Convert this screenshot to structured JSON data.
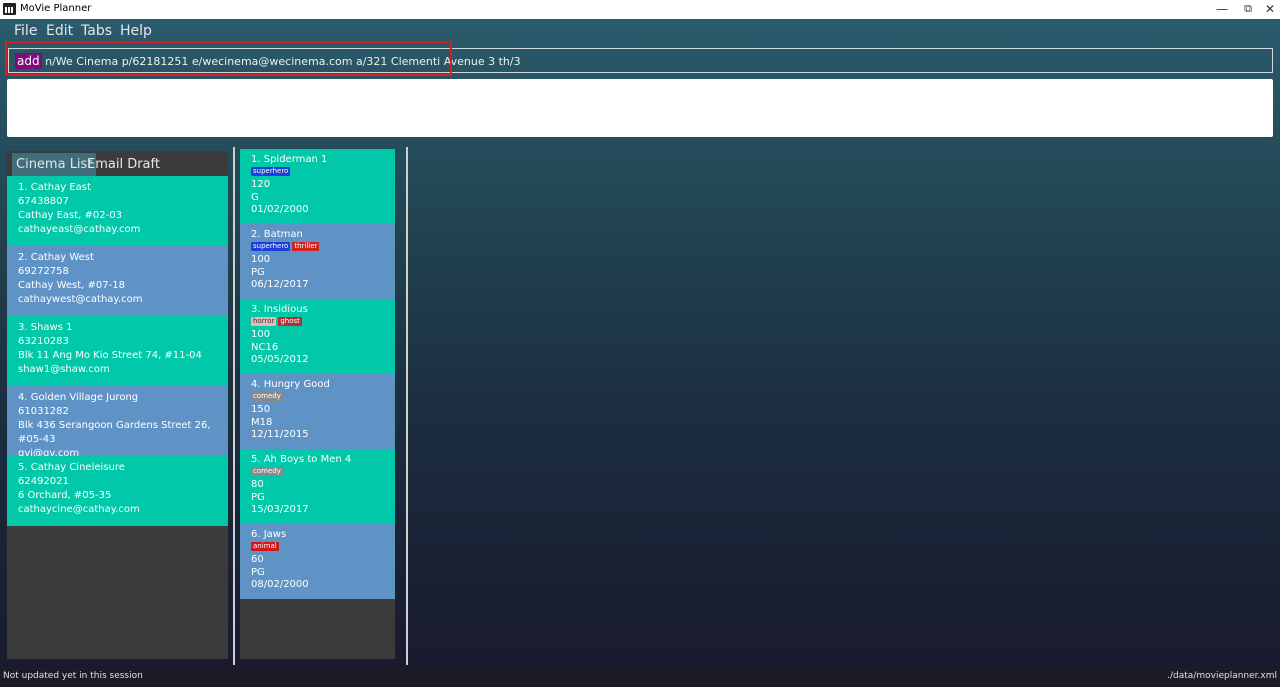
{
  "window": {
    "title": "MoVie Planner",
    "minimize": "—",
    "restore": "⧉",
    "close": "✕"
  },
  "menu": [
    "File",
    "Edit",
    "Tabs",
    "Help"
  ],
  "command": {
    "keyword": "add",
    "args": "n/We Cinema p/62181251 e/wecinema@wecinema.com a/321 Clementi Avenue 3 th/3"
  },
  "result": "",
  "tabs": [
    "Cinema List",
    "Email Draft"
  ],
  "cinemas": [
    {
      "title": "1.  Cathay East",
      "phone": "67438807",
      "address": "Cathay East, #02-03",
      "email": "cathayeast@cathay.com"
    },
    {
      "title": "2.  Cathay West",
      "phone": "69272758",
      "address": "Cathay West, #07-18",
      "email": "cathaywest@cathay.com"
    },
    {
      "title": "3.  Shaws 1",
      "phone": "63210283",
      "address": "Blk 11 Ang Mo Kio Street 74, #11-04",
      "email": "shaw1@shaw.com"
    },
    {
      "title": "4.  Golden Village Jurong",
      "phone": "61031282",
      "address": "Blk 436 Serangoon Gardens Street 26, #05-43",
      "email": "gvj@gv.com"
    },
    {
      "title": "5.  Cathay Cineleisure",
      "phone": "62492021",
      "address": "6 Orchard, #05-35",
      "email": "cathaycine@cathay.com"
    }
  ],
  "movies": [
    {
      "title": "1.  Spiderman 1",
      "tags": [
        {
          "label": "superhero",
          "color": "#1a3fdc"
        }
      ],
      "duration": "120",
      "rating": "G",
      "date": "01/02/2000"
    },
    {
      "title": "2.  Batman",
      "tags": [
        {
          "label": "superhero",
          "color": "#1a3fdc"
        },
        {
          "label": "thriller",
          "color": "#d02020"
        }
      ],
      "duration": "100",
      "rating": "PG",
      "date": "06/12/2017"
    },
    {
      "title": "3.  Insidious",
      "tags": [
        {
          "label": "horror",
          "color": "#e8b8b8"
        },
        {
          "label": "ghost",
          "color": "#b03030"
        }
      ],
      "duration": "100",
      "rating": "NC16",
      "date": "05/05/2012"
    },
    {
      "title": "4.  Hungry Good",
      "tags": [
        {
          "label": "comedy",
          "color": "#8a8a8a"
        }
      ],
      "duration": "150",
      "rating": "M18",
      "date": "12/11/2015"
    },
    {
      "title": "5.  Ah Boys to Men 4",
      "tags": [
        {
          "label": "comedy",
          "color": "#8a8a8a"
        }
      ],
      "duration": "80",
      "rating": "PG",
      "date": "15/03/2017"
    },
    {
      "title": "6.  Jaws",
      "tags": [
        {
          "label": "animal",
          "color": "#d01818"
        }
      ],
      "duration": "60",
      "rating": "PG",
      "date": "08/02/2000"
    }
  ],
  "status": {
    "left": "Not updated yet in this session",
    "right": "./data/movieplanner.xml"
  },
  "colors": {
    "teal_card": "#00c8a8",
    "blue_card": "#5f93c5",
    "highlight": "#d81e1e"
  }
}
